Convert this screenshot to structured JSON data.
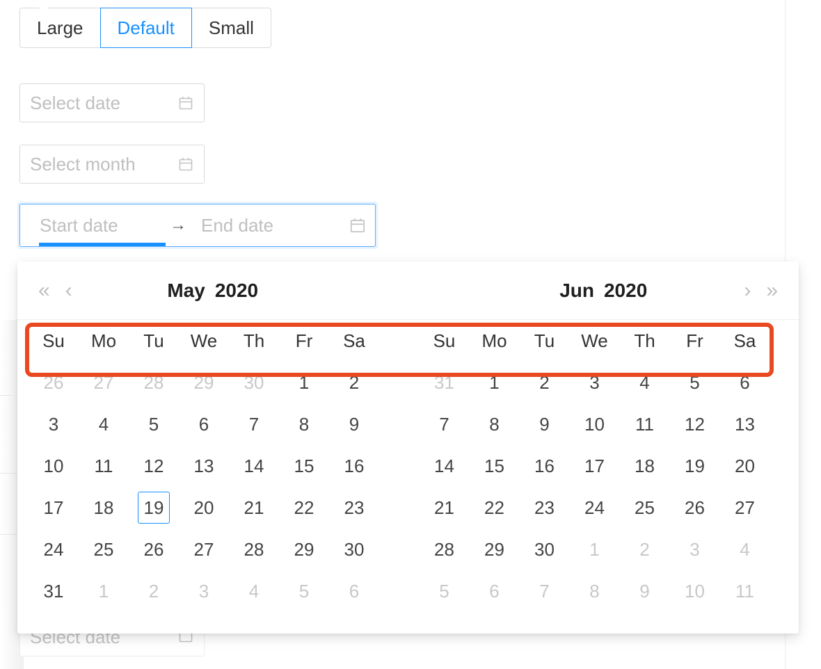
{
  "size_group": {
    "options": [
      {
        "label": "Large",
        "active": false
      },
      {
        "label": "Default",
        "active": true
      },
      {
        "label": "Small",
        "active": false
      }
    ],
    "selected": "Default",
    "accent_color": "#1890ff",
    "border_color": "#d9d9d9"
  },
  "pickers": {
    "date": {
      "placeholder": "Select date",
      "value": "",
      "icon": "calendar-icon"
    },
    "month": {
      "placeholder": "Select month",
      "value": "",
      "icon": "calendar-icon"
    },
    "bottom_date": {
      "placeholder": "Select date",
      "value": "",
      "icon": "calendar-icon"
    }
  },
  "range_picker": {
    "start_placeholder": "Start date",
    "end_placeholder": "End date",
    "start_value": "",
    "end_value": "",
    "separator": "→",
    "icon": "calendar-icon",
    "focused_segment": "start",
    "focus_color": "#1890ff",
    "border_color": "#5aabff"
  },
  "panel": {
    "nav": {
      "super_prev": "«",
      "prev": "‹",
      "next": "›",
      "super_next": "»"
    },
    "weekdays": [
      "Su",
      "Mo",
      "Tu",
      "We",
      "Th",
      "Fr",
      "Sa"
    ],
    "months": [
      {
        "month_label": "May",
        "year_label": "2020",
        "weeks": [
          [
            {
              "d": "26",
              "out": true
            },
            {
              "d": "27",
              "out": true
            },
            {
              "d": "28",
              "out": true
            },
            {
              "d": "29",
              "out": true
            },
            {
              "d": "30",
              "out": true
            },
            {
              "d": "1",
              "out": false
            },
            {
              "d": "2",
              "out": false
            }
          ],
          [
            {
              "d": "3",
              "out": false
            },
            {
              "d": "4",
              "out": false
            },
            {
              "d": "5",
              "out": false
            },
            {
              "d": "6",
              "out": false
            },
            {
              "d": "7",
              "out": false
            },
            {
              "d": "8",
              "out": false
            },
            {
              "d": "9",
              "out": false
            }
          ],
          [
            {
              "d": "10",
              "out": false
            },
            {
              "d": "11",
              "out": false
            },
            {
              "d": "12",
              "out": false
            },
            {
              "d": "13",
              "out": false
            },
            {
              "d": "14",
              "out": false
            },
            {
              "d": "15",
              "out": false
            },
            {
              "d": "16",
              "out": false
            }
          ],
          [
            {
              "d": "17",
              "out": false
            },
            {
              "d": "18",
              "out": false
            },
            {
              "d": "19",
              "out": false,
              "today": true
            },
            {
              "d": "20",
              "out": false
            },
            {
              "d": "21",
              "out": false
            },
            {
              "d": "22",
              "out": false
            },
            {
              "d": "23",
              "out": false
            }
          ],
          [
            {
              "d": "24",
              "out": false
            },
            {
              "d": "25",
              "out": false
            },
            {
              "d": "26",
              "out": false
            },
            {
              "d": "27",
              "out": false
            },
            {
              "d": "28",
              "out": false
            },
            {
              "d": "29",
              "out": false
            },
            {
              "d": "30",
              "out": false
            }
          ],
          [
            {
              "d": "31",
              "out": false
            },
            {
              "d": "1",
              "out": true
            },
            {
              "d": "2",
              "out": true
            },
            {
              "d": "3",
              "out": true
            },
            {
              "d": "4",
              "out": true
            },
            {
              "d": "5",
              "out": true
            },
            {
              "d": "6",
              "out": true
            }
          ]
        ]
      },
      {
        "month_label": "Jun",
        "year_label": "2020",
        "weeks": [
          [
            {
              "d": "31",
              "out": true
            },
            {
              "d": "1",
              "out": false
            },
            {
              "d": "2",
              "out": false
            },
            {
              "d": "3",
              "out": false
            },
            {
              "d": "4",
              "out": false
            },
            {
              "d": "5",
              "out": false
            },
            {
              "d": "6",
              "out": false
            }
          ],
          [
            {
              "d": "7",
              "out": false
            },
            {
              "d": "8",
              "out": false
            },
            {
              "d": "9",
              "out": false
            },
            {
              "d": "10",
              "out": false
            },
            {
              "d": "11",
              "out": false
            },
            {
              "d": "12",
              "out": false
            },
            {
              "d": "13",
              "out": false
            }
          ],
          [
            {
              "d": "14",
              "out": false
            },
            {
              "d": "15",
              "out": false
            },
            {
              "d": "16",
              "out": false
            },
            {
              "d": "17",
              "out": false
            },
            {
              "d": "18",
              "out": false
            },
            {
              "d": "19",
              "out": false
            },
            {
              "d": "20",
              "out": false
            }
          ],
          [
            {
              "d": "21",
              "out": false
            },
            {
              "d": "22",
              "out": false
            },
            {
              "d": "23",
              "out": false
            },
            {
              "d": "24",
              "out": false
            },
            {
              "d": "25",
              "out": false
            },
            {
              "d": "26",
              "out": false
            },
            {
              "d": "27",
              "out": false
            }
          ],
          [
            {
              "d": "28",
              "out": false
            },
            {
              "d": "29",
              "out": false
            },
            {
              "d": "30",
              "out": false
            },
            {
              "d": "1",
              "out": true
            },
            {
              "d": "2",
              "out": true
            },
            {
              "d": "3",
              "out": true
            },
            {
              "d": "4",
              "out": true
            }
          ],
          [
            {
              "d": "5",
              "out": true
            },
            {
              "d": "6",
              "out": true
            },
            {
              "d": "7",
              "out": true
            },
            {
              "d": "8",
              "out": true
            },
            {
              "d": "9",
              "out": true
            },
            {
              "d": "10",
              "out": true
            },
            {
              "d": "11",
              "out": true
            }
          ]
        ]
      }
    ]
  },
  "annotation": {
    "target": "weekday-header-row",
    "color": "#e8491f"
  }
}
